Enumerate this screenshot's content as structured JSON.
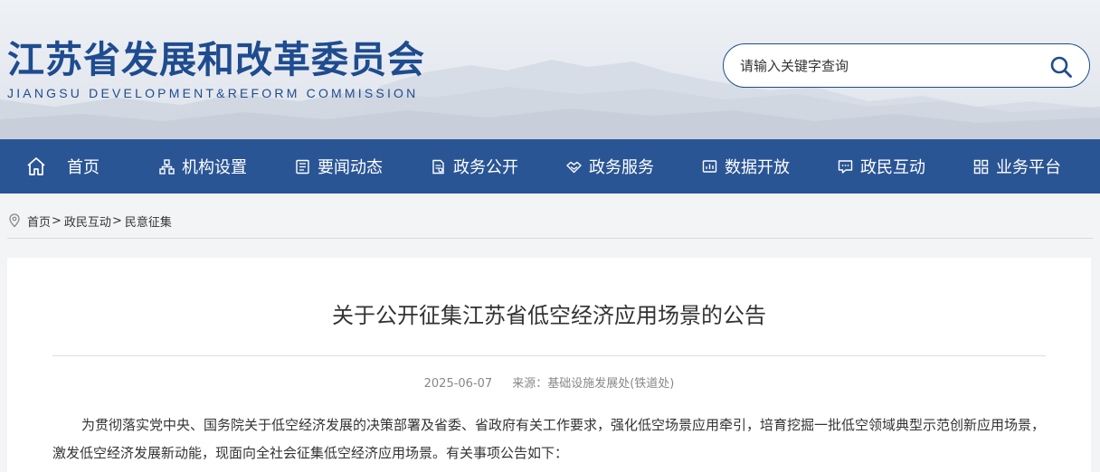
{
  "header": {
    "title": "江苏省发展和改革委员会",
    "subtitle": "JIANGSU DEVELOPMENT&REFORM COMMISSION",
    "search_placeholder": "请输入关键字查询"
  },
  "nav": {
    "items": [
      {
        "label": "首页",
        "icon": "home-icon"
      },
      {
        "label": "机构设置",
        "icon": "org-chart-icon"
      },
      {
        "label": "要闻动态",
        "icon": "news-icon"
      },
      {
        "label": "政务公开",
        "icon": "document-icon"
      },
      {
        "label": "政务服务",
        "icon": "handshake-icon"
      },
      {
        "label": "数据开放",
        "icon": "data-chart-icon"
      },
      {
        "label": "政民互动",
        "icon": "chat-icon"
      },
      {
        "label": "业务平台",
        "icon": "grid-icon"
      }
    ]
  },
  "breadcrumb": {
    "items": [
      "首页",
      "政民互动",
      "民意征集"
    ],
    "separator": ">"
  },
  "article": {
    "title": "关于公开征集江苏省低空经济应用场景的公告",
    "date": "2025-06-07",
    "source": "来源：基础设施发展处(铁道处)",
    "paragraph": "为贯彻落实党中央、国务院关于低空经济发展的决策部署及省委、省政府有关工作要求，强化低空场景应用牵引，培育挖掘一批低空领域典型示范创新应用场景，激发低空经济发展新动能，现面向全社会征集低空经济应用场景。有关事项公告如下："
  },
  "colors": {
    "brand": "#1f4c8f",
    "nav_bg": "#2a5595"
  }
}
